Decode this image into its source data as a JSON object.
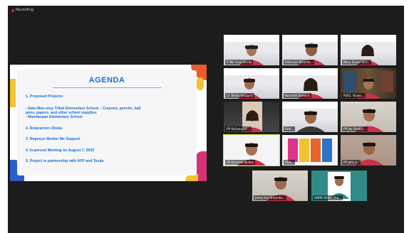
{
  "window": {
    "recording_label": "Recording"
  },
  "slide": {
    "title": "AGENDA",
    "items": [
      "1. Proposed Projects:",
      "- Datu Man-oloy Tribal Elementary School – Crayons, pencils, ball",
      "pens, papers, and other school supplies.",
      "- Mandacpan Elementary School",
      "2. Rotaractors Dislas",
      "3. Negosyo Mentor Me Support",
      "4. In-person Meeting on August 7, 2020",
      "5. Project in partnership with AFP and Tesda"
    ]
  },
  "participants": [
    {
      "name": "P. Mc Cruz Arcilla"
    },
    {
      "name": "Patrician Ricardo..."
    },
    {
      "name": "Mary Grace Vict..."
    },
    {
      "name": "Lt. Ehlen Vasquez"
    },
    {
      "name": "Kenneth Samora"
    },
    {
      "name": "RDCL Yuson..."
    },
    {
      "name": "PP Rohana / C..."
    },
    {
      "name": "Deb..."
    },
    {
      "name": "PP Jay Snakin..."
    },
    {
      "name": "PP Rommel Nuñez"
    },
    {
      "name": "PDA..."
    },
    {
      "name": "PP John J..."
    },
    {
      "name": "Johny Ivy Almonte..."
    },
    {
      "name": "ADRR Almar Dal..."
    }
  ],
  "colors": {
    "accent": "#1a6fd1",
    "brand_red": "#c8324a",
    "active_border": "#c9e84c"
  }
}
